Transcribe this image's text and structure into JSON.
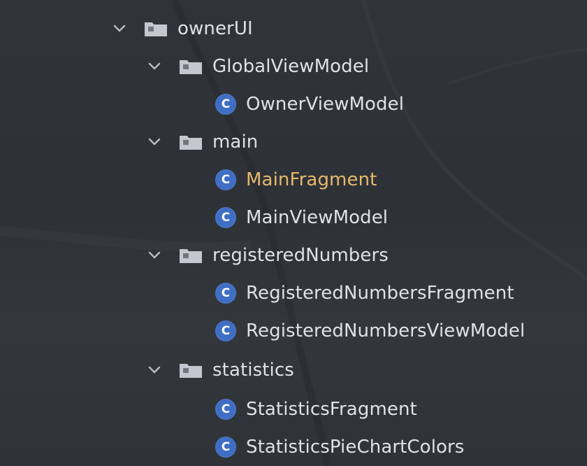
{
  "tree": {
    "nodes": [
      {
        "label": "ownerUI",
        "type": "folder",
        "depth": 0,
        "expanded": true
      },
      {
        "label": "GlobalViewModel",
        "type": "folder",
        "depth": 1,
        "expanded": true
      },
      {
        "label": "OwnerViewModel",
        "type": "class",
        "depth": 2,
        "icon_letter": "C"
      },
      {
        "label": "main",
        "type": "folder",
        "depth": 1,
        "expanded": true
      },
      {
        "label": "MainFragment",
        "type": "class",
        "depth": 2,
        "icon_letter": "C",
        "modified": true
      },
      {
        "label": "MainViewModel",
        "type": "class",
        "depth": 2,
        "icon_letter": "C"
      },
      {
        "label": "registeredNumbers",
        "type": "folder",
        "depth": 1,
        "expanded": true
      },
      {
        "label": "RegisteredNumbersFragment",
        "type": "class",
        "depth": 2,
        "icon_letter": "C"
      },
      {
        "label": "RegisteredNumbersViewModel",
        "type": "class",
        "depth": 2,
        "icon_letter": "C"
      },
      {
        "label": "statistics",
        "type": "folder",
        "depth": 1,
        "expanded": true
      },
      {
        "label": "StatisticsFragment",
        "type": "class",
        "depth": 2,
        "icon_letter": "C"
      },
      {
        "label": "StatisticsPieChartColors",
        "type": "class",
        "depth": 2,
        "icon_letter": "C"
      }
    ]
  },
  "colors": {
    "background": "#2f3338",
    "text": "#dfe1e5",
    "modified_text": "#e6b96a",
    "class_icon": "#3f6ec5",
    "folder_icon": "#c3c8d0",
    "chevron": "#b9bec6"
  },
  "icons": {
    "chevron": "chevron-down-icon",
    "folder": "folder-icon",
    "class": "class-icon"
  }
}
